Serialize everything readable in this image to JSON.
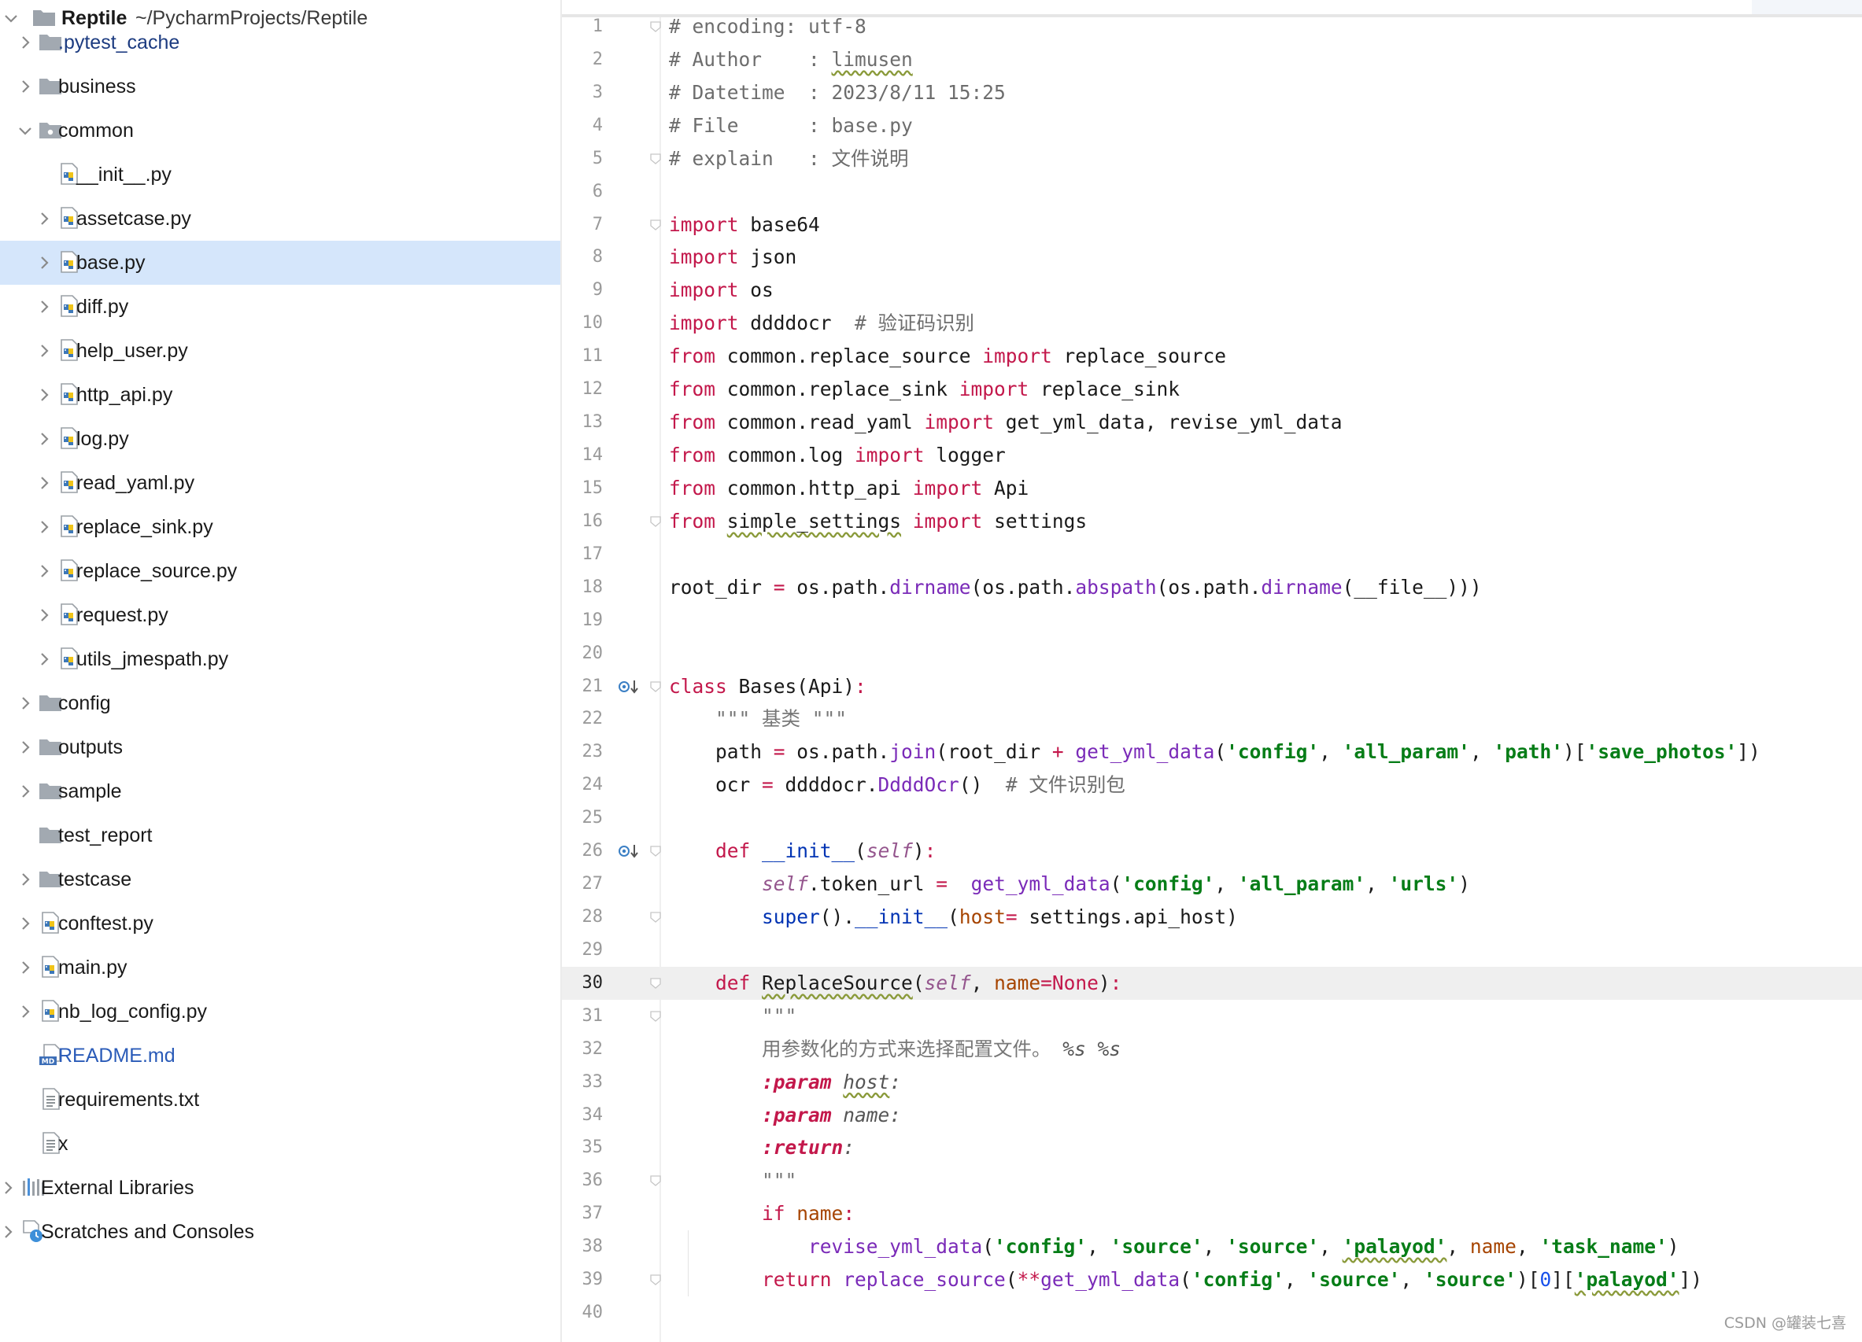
{
  "project": {
    "name": "Reptile",
    "path": "~/PycharmProjects/Reptile"
  },
  "tree": [
    {
      "label": ".pytest_cache",
      "type": "folder",
      "expanded": false,
      "labelColor": "#1c3b80"
    },
    {
      "label": "business",
      "type": "folder",
      "expanded": false
    },
    {
      "label": "common",
      "type": "package",
      "expanded": true
    },
    {
      "label": "__init__.py",
      "type": "python",
      "level": 2
    },
    {
      "label": "assetcase.py",
      "type": "python",
      "level": 2,
      "expandable": true
    },
    {
      "label": "base.py",
      "type": "python",
      "level": 2,
      "expandable": true,
      "selected": true
    },
    {
      "label": "diff.py",
      "type": "python",
      "level": 2,
      "expandable": true
    },
    {
      "label": "help_user.py",
      "type": "python",
      "level": 2,
      "expandable": true
    },
    {
      "label": "http_api.py",
      "type": "python",
      "level": 2,
      "expandable": true
    },
    {
      "label": "log.py",
      "type": "python",
      "level": 2,
      "expandable": true
    },
    {
      "label": "read_yaml.py",
      "type": "python",
      "level": 2,
      "expandable": true
    },
    {
      "label": "replace_sink.py",
      "type": "python",
      "level": 2,
      "expandable": true
    },
    {
      "label": "replace_source.py",
      "type": "python",
      "level": 2,
      "expandable": true
    },
    {
      "label": "request.py",
      "type": "python",
      "level": 2,
      "expandable": true
    },
    {
      "label": "utils_jmespath.py",
      "type": "python",
      "level": 2,
      "expandable": true
    },
    {
      "label": "config",
      "type": "folder",
      "expanded": false
    },
    {
      "label": "outputs",
      "type": "folder",
      "expanded": false
    },
    {
      "label": "sample",
      "type": "folder",
      "expanded": false
    },
    {
      "label": "test_report",
      "type": "folder",
      "expandable": false
    },
    {
      "label": "testcase",
      "type": "folder",
      "expanded": false
    },
    {
      "label": "conftest.py",
      "type": "python",
      "level": 1,
      "expandable": true
    },
    {
      "label": "main.py",
      "type": "python",
      "level": 1,
      "expandable": true
    },
    {
      "label": "nb_log_config.py",
      "type": "python",
      "level": 1,
      "expandable": true
    },
    {
      "label": "README.md",
      "type": "markdown",
      "level": 1
    },
    {
      "label": "requirements.txt",
      "type": "text",
      "level": 1
    },
    {
      "label": "x",
      "type": "text",
      "level": 1
    },
    {
      "label": "External Libraries",
      "type": "libraries",
      "level": 0,
      "expandable": true
    },
    {
      "label": "Scratches and Consoles",
      "type": "scratches",
      "level": 0,
      "expandable": true
    }
  ],
  "editor": {
    "current_line": 30,
    "lines": [
      [
        [
          "c-com",
          "# encoding: utf-8"
        ]
      ],
      [
        [
          "c-com",
          "# Author    : "
        ],
        [
          "c-com wavy",
          "limusen"
        ]
      ],
      [
        [
          "c-com",
          "# Datetime  : 2023/8/11 15:25"
        ]
      ],
      [
        [
          "c-com",
          "# File      : base.py"
        ]
      ],
      [
        [
          "c-com",
          "# explain   : 文件说明"
        ]
      ],
      [],
      [
        [
          "c-kw",
          "import"
        ],
        [
          "",
          "base64"
        ]
      ],
      [
        [
          "c-kw",
          "import"
        ],
        [
          "",
          "json"
        ]
      ],
      [
        [
          "c-kw",
          "import"
        ],
        [
          "",
          "os"
        ]
      ],
      [
        [
          "c-kw",
          "import"
        ],
        [
          "",
          "ddddocr  "
        ],
        [
          "c-com",
          "# 验证码识别"
        ]
      ],
      [
        [
          "c-kw",
          "from"
        ],
        [
          "",
          "common.replace_source "
        ],
        [
          "c-kw",
          "import"
        ],
        [
          "",
          "replace_source"
        ]
      ],
      [
        [
          "c-kw",
          "from"
        ],
        [
          "",
          "common.replace_sink "
        ],
        [
          "c-kw",
          "import"
        ],
        [
          "",
          "replace_sink"
        ]
      ],
      [
        [
          "c-kw",
          "from"
        ],
        [
          "",
          "common.read_yaml "
        ],
        [
          "c-kw",
          "import"
        ],
        [
          "",
          "get_yml_data, revise_yml_data"
        ]
      ],
      [
        [
          "c-kw",
          "from"
        ],
        [
          "",
          "common.log "
        ],
        [
          "c-kw",
          "import"
        ],
        [
          "",
          "logger"
        ]
      ],
      [
        [
          "c-kw",
          "from"
        ],
        [
          "",
          "common.http_api "
        ],
        [
          "c-kw",
          "import"
        ],
        [
          "",
          "Api"
        ]
      ],
      [
        [
          "c-kw",
          "from"
        ],
        [
          "wavy",
          "simple_settings"
        ],
        [
          "",
          " "
        ],
        [
          "c-kw",
          "import"
        ],
        [
          "",
          "settings"
        ]
      ],
      [],
      [
        [
          "",
          "root_dir "
        ],
        [
          "c-kw",
          "="
        ],
        [
          "",
          "os.path."
        ],
        [
          "c-fn",
          "dirname"
        ],
        [
          "",
          "(os.path."
        ],
        [
          "c-fn",
          "abspath"
        ],
        [
          "",
          "(os.path."
        ],
        [
          "c-fn",
          "dirname"
        ],
        [
          "",
          "(__file__)))"
        ]
      ],
      [],
      [],
      [
        [
          "c-kw",
          "class"
        ],
        [
          "",
          "Bases(Api)"
        ],
        [
          "c-kw",
          ":"
        ]
      ],
      [
        [
          "",
          "    "
        ],
        [
          "c-doc",
          "\"\"\" 基类 \"\"\""
        ]
      ],
      [
        [
          "",
          "    path "
        ],
        [
          "c-kw",
          "="
        ],
        [
          "",
          "os.path."
        ],
        [
          "c-fn",
          "join"
        ],
        [
          "",
          "(root_dir "
        ],
        [
          "c-kw",
          "+"
        ],
        [
          "",
          " "
        ],
        [
          "c-fn",
          "get_yml_data"
        ],
        [
          "",
          "("
        ],
        [
          "c-str",
          "'config'"
        ],
        [
          "",
          ", "
        ],
        [
          "c-str",
          "'all_param'"
        ],
        [
          "",
          ", "
        ],
        [
          "c-str",
          "'path'"
        ],
        [
          "",
          ")["
        ],
        [
          "c-str",
          "'save_photos'"
        ],
        [
          "",
          "])"
        ]
      ],
      [
        [
          "",
          "    ocr "
        ],
        [
          "c-kw",
          "="
        ],
        [
          "",
          "ddddocr."
        ],
        [
          "c-fn",
          "DdddOcr"
        ],
        [
          "",
          "()  "
        ],
        [
          "c-com",
          "# 文件识别包"
        ]
      ],
      [],
      [
        [
          "",
          "    "
        ],
        [
          "c-kw",
          "def"
        ],
        [
          "",
          " "
        ],
        [
          "c-builtin",
          "__init__"
        ],
        [
          "",
          "("
        ],
        [
          "c-self",
          "self"
        ],
        [
          "",
          ")"
        ],
        [
          "c-kw",
          ":"
        ]
      ],
      [
        [
          "",
          "        "
        ],
        [
          "c-self",
          "self"
        ],
        [
          "",
          ".token_url "
        ],
        [
          "c-kw",
          "="
        ],
        [
          "",
          " "
        ],
        [
          "c-fn",
          "get_yml_data"
        ],
        [
          "",
          "("
        ],
        [
          "c-str",
          "'config'"
        ],
        [
          "",
          ", "
        ],
        [
          "c-str",
          "'all_param'"
        ],
        [
          "",
          ", "
        ],
        [
          "c-str",
          "'urls'"
        ],
        [
          "",
          ")"
        ]
      ],
      [
        [
          "",
          "        "
        ],
        [
          "c-builtin",
          "super"
        ],
        [
          "",
          "()."
        ],
        [
          "c-builtin",
          "__init__"
        ],
        [
          "",
          "("
        ],
        [
          "c-param",
          "host"
        ],
        [
          "c-kw",
          "="
        ],
        [
          "",
          "settings.api_host)"
        ]
      ],
      [],
      [
        [
          "",
          "    "
        ],
        [
          "c-kw",
          "def"
        ],
        [
          "",
          " "
        ],
        [
          "wavy",
          "ReplaceSource"
        ],
        [
          "",
          "("
        ],
        [
          "c-self",
          "self"
        ],
        [
          "",
          ", "
        ],
        [
          "c-param",
          "name"
        ],
        [
          "c-kw",
          "=None"
        ],
        [
          "",
          ")"
        ],
        [
          "c-kw",
          ":"
        ]
      ],
      [
        [
          "",
          "        "
        ],
        [
          "c-doc",
          "\"\"\""
        ]
      ],
      [
        [
          "",
          "        "
        ],
        [
          "c-doc",
          "用参数化的方式来选择配置文件。 "
        ],
        [
          "c-docvar",
          "%s %s"
        ]
      ],
      [
        [
          "",
          "        "
        ],
        [
          "c-doctag",
          ":param"
        ],
        [
          "",
          " "
        ],
        [
          "c-docvar wavy",
          "host"
        ],
        [
          "c-docvar",
          ":"
        ]
      ],
      [
        [
          "",
          "        "
        ],
        [
          "c-doctag",
          ":param"
        ],
        [
          "",
          " "
        ],
        [
          "c-docvar",
          "name:"
        ]
      ],
      [
        [
          "",
          "        "
        ],
        [
          "c-doctag",
          ":return"
        ],
        [
          "c-docvar",
          ":"
        ]
      ],
      [
        [
          "",
          "        "
        ],
        [
          "c-doc",
          "\"\"\""
        ]
      ],
      [
        [
          "",
          "        "
        ],
        [
          "c-kw",
          "if"
        ],
        [
          "",
          " "
        ],
        [
          "c-param",
          "name"
        ],
        [
          "c-kw",
          ":"
        ]
      ],
      [
        [
          "",
          "            "
        ],
        [
          "c-fn",
          "revise_yml_data"
        ],
        [
          "",
          "("
        ],
        [
          "c-str",
          "'config'"
        ],
        [
          "",
          ", "
        ],
        [
          "c-str",
          "'source'"
        ],
        [
          "",
          ", "
        ],
        [
          "c-str",
          "'source'"
        ],
        [
          "",
          ", "
        ],
        [
          "c-str wavy",
          "'palayod'"
        ],
        [
          "",
          ", "
        ],
        [
          "c-param",
          "name"
        ],
        [
          "",
          ", "
        ],
        [
          "c-str",
          "'task_name'"
        ],
        [
          "",
          ")"
        ]
      ],
      [
        [
          "",
          "        "
        ],
        [
          "c-kw",
          "return"
        ],
        [
          "",
          " "
        ],
        [
          "c-fn",
          "replace_source"
        ],
        [
          "",
          "("
        ],
        [
          "c-kw",
          "**"
        ],
        [
          "c-fn",
          "get_yml_data"
        ],
        [
          "",
          "("
        ],
        [
          "c-str",
          "'config'"
        ],
        [
          "",
          ", "
        ],
        [
          "c-str",
          "'source'"
        ],
        [
          "",
          ", "
        ],
        [
          "c-str",
          "'source'"
        ],
        [
          "",
          ")["
        ],
        [
          "c-num",
          "0"
        ],
        [
          "",
          "]["
        ],
        [
          "c-str wavy",
          "'palayod'"
        ],
        [
          "",
          "])"
        ]
      ],
      []
    ]
  },
  "watermark": "CSDN @罐装七喜"
}
